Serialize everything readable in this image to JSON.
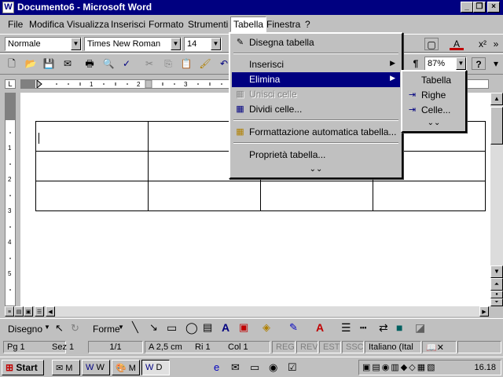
{
  "window": {
    "title": "Documento6 - Microsoft Word",
    "app_icon": "W"
  },
  "menubar": [
    "File",
    "Modifica",
    "Visualizza",
    "Inserisci",
    "Formato",
    "Strumenti",
    "Tabella",
    "Finestra",
    "?"
  ],
  "formatting": {
    "style": "Normale",
    "font": "Times New Roman",
    "size": "14",
    "zoom": "87%"
  },
  "table_menu": {
    "items": [
      {
        "label": "Disegna tabella"
      },
      {
        "label": "Inserisci"
      },
      {
        "label": "Elimina"
      },
      {
        "label": "Unisci celle"
      },
      {
        "label": "Dividi celle..."
      },
      {
        "label": "Formattazione automatica tabella..."
      },
      {
        "label": "Proprietà tabella..."
      }
    ]
  },
  "elimina_submenu": {
    "items": [
      {
        "label": "Tabella"
      },
      {
        "label": "Righe"
      },
      {
        "label": "Celle..."
      }
    ]
  },
  "drawing": {
    "draw_label": "Disegno",
    "shapes_label": "Forme"
  },
  "status": {
    "page": "Pg 1",
    "section": "Sez 1",
    "pages": "1/1",
    "at": "A 2,5 cm",
    "line": "Ri 1",
    "col": "Col 1",
    "rec": "REG",
    "rev": "REV",
    "ext": "EST",
    "ovr": "SSC",
    "lang": "Italiano (Ital"
  },
  "taskbar": {
    "start": "Start",
    "tasks": [
      "M",
      "W",
      "M",
      "D"
    ],
    "clock": "16.18"
  },
  "icons": {
    "new": "new-document-icon",
    "open": "open-folder-icon",
    "save": "save-icon",
    "print": "print-icon",
    "cut": "cut-icon",
    "copy": "copy-icon",
    "paste": "paste-icon",
    "pilcrow": "show-formatting-icon"
  }
}
